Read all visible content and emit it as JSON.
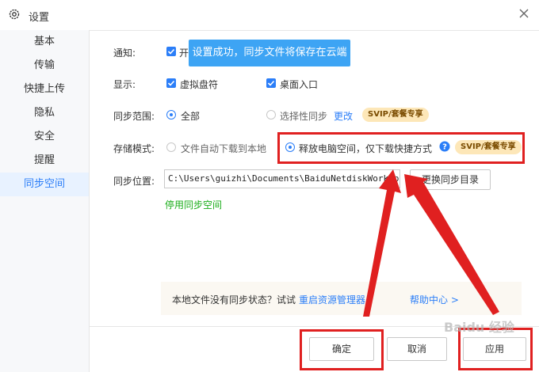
{
  "window": {
    "title": "设置",
    "icon": "gear-icon",
    "close_icon": "close-icon"
  },
  "sidebar": {
    "items": [
      {
        "label": "基本",
        "active": false
      },
      {
        "label": "传输",
        "active": false
      },
      {
        "label": "快捷上传",
        "active": false
      },
      {
        "label": "隐私",
        "active": false
      },
      {
        "label": "安全",
        "active": false
      },
      {
        "label": "提醒",
        "active": false
      },
      {
        "label": "同步空间",
        "active": true
      }
    ]
  },
  "toast": {
    "text": "设置成功，同步文件将保存在云端"
  },
  "settings": {
    "notify": {
      "label": "通知:",
      "option": "开",
      "checked": true
    },
    "display": {
      "label": "显示:",
      "options": [
        {
          "label": "虚拟盘符",
          "checked": true
        },
        {
          "label": "桌面入口",
          "checked": true
        }
      ]
    },
    "sync_scope": {
      "label": "同步范围:",
      "option_all": "全部",
      "option_selective": "选择性同步",
      "change_link": "更改",
      "badge": "SVIP/套餐专享",
      "selected": "全部"
    },
    "storage_mode": {
      "label": "存储模式:",
      "option_auto": "文件自动下载到本地",
      "option_free": "释放电脑空间，仅下载快捷方式",
      "help_icon": "question-icon",
      "badge": "SVIP/套餐专享",
      "selected": "释放电脑空间，仅下载快捷方式"
    },
    "sync_location": {
      "label": "同步位置:",
      "path": "C:\\Users\\guizhi\\Documents\\BaiduNetdiskWorkspace",
      "change_button": "更换同步目录",
      "disable_link": "停用同步空间"
    }
  },
  "help_bar": {
    "text": "本地文件没有同步状态？试试",
    "restart_link": "重启资源管理器",
    "help_center_link": "帮助中心 >"
  },
  "footer": {
    "ok": "确定",
    "cancel": "取消",
    "apply": "应用"
  },
  "watermark": "Baidu 经验",
  "colors": {
    "accent": "#2b7ef8",
    "toast": "#3da4f4",
    "badge": "#fde7b8",
    "annotation": "#e02020",
    "sync_link": "#1aad19"
  }
}
